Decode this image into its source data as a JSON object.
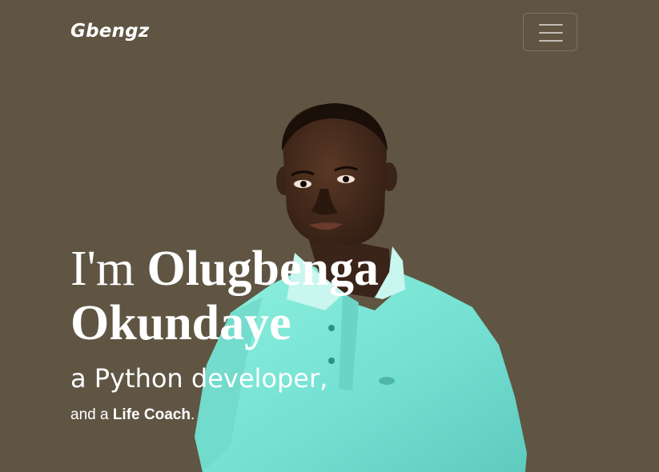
{
  "navbar": {
    "brand": "Gbengz",
    "menu_icon": "hamburger-menu-icon"
  },
  "hero": {
    "intro": "I'm ",
    "name_first": "Olugbenga",
    "name_last": "Okundaye",
    "role": "a Python developer,",
    "sub_prefix": "and a ",
    "sub_highlight": "Life Coach",
    "sub_suffix": "."
  },
  "colors": {
    "background": "#5f5542",
    "text": "#ffffff",
    "shirt": "#7fe6d6",
    "skin": "#3b2418"
  }
}
